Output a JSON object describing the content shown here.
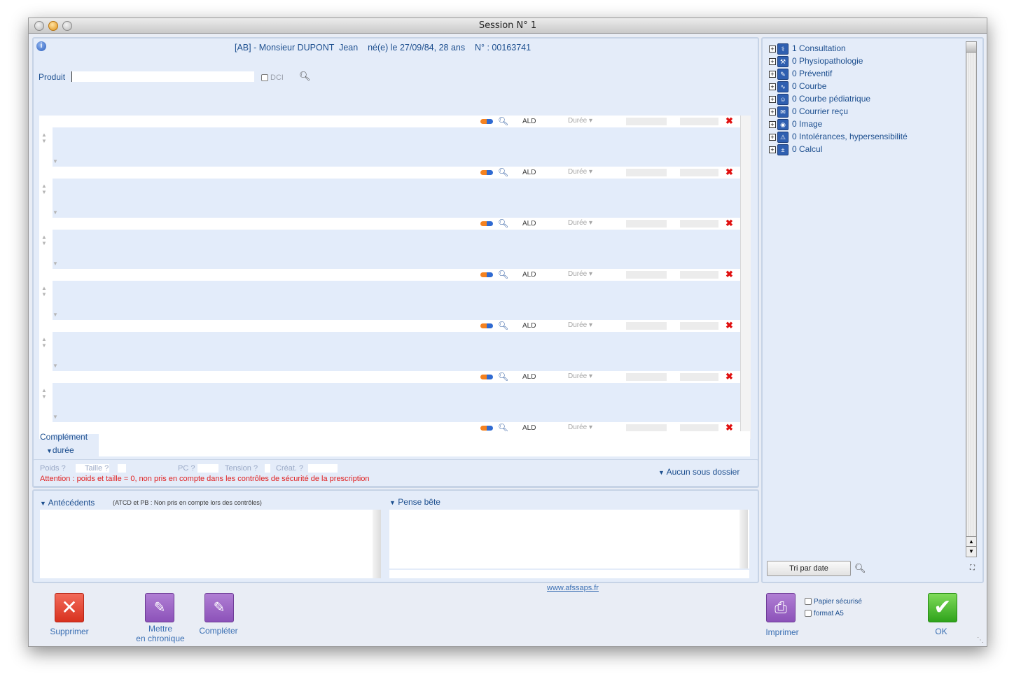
{
  "window": {
    "title": "Session N° 1"
  },
  "patient": {
    "header": "[AB] - Monsieur DUPONT  Jean    né(e) le 27/09/84, 28 ans    N° : 00163741"
  },
  "search": {
    "product_label": "Produit",
    "dci_label": "DCI"
  },
  "rx_row": {
    "ald_label": "ALD",
    "duration_label": "Durée"
  },
  "complement": {
    "label": "Complément",
    "duration_toggle": "durée"
  },
  "vitals": {
    "poids": "Poids ?",
    "taille": "Taille ?",
    "pc": "PC ?",
    "tension": "Tension ?",
    "creat": "Créat. ?"
  },
  "warning": "Attention : poids et taille = 0, non pris en compte dans les contrôles de sécurité de la prescription",
  "subfolder": "Aucun sous dossier",
  "antecedents": {
    "label": "Antécédents",
    "note": "(ATCD et PB : Non pris en compte lors des contrôles)"
  },
  "memo": {
    "label": "Pense bête"
  },
  "link": "www.afssaps.fr",
  "tree": [
    {
      "label": "1 Consultation",
      "icon": "stethoscope-icon"
    },
    {
      "label": "0 Physiopathologie",
      "icon": "wrench-icon"
    },
    {
      "label": "0 Préventif",
      "icon": "syringe-icon"
    },
    {
      "label": "0 Courbe",
      "icon": "chart-icon"
    },
    {
      "label": "0 Courbe pédiatrique",
      "icon": "child-icon"
    },
    {
      "label": "0 Courrier reçu",
      "icon": "mail-icon"
    },
    {
      "label": "0 Image",
      "icon": "camera-icon"
    },
    {
      "label": "0 Intolérances, hypersensibilité",
      "icon": "allergy-icon"
    },
    {
      "label": "0 Calcul",
      "icon": "calculator-icon"
    }
  ],
  "sort_button": "Tri par date",
  "buttons": {
    "delete": "Supprimer",
    "chronic_line1": "Mettre",
    "chronic_line2": "en chronique",
    "complete": "Compléter",
    "print": "Imprimer",
    "ok": "OK",
    "secure_paper": "Papier sécurisé",
    "format_a5": "format A5"
  },
  "colors": {
    "accent": "#1d4f8f",
    "warning": "#e02020",
    "panel_bg": "#e4ecf9"
  }
}
